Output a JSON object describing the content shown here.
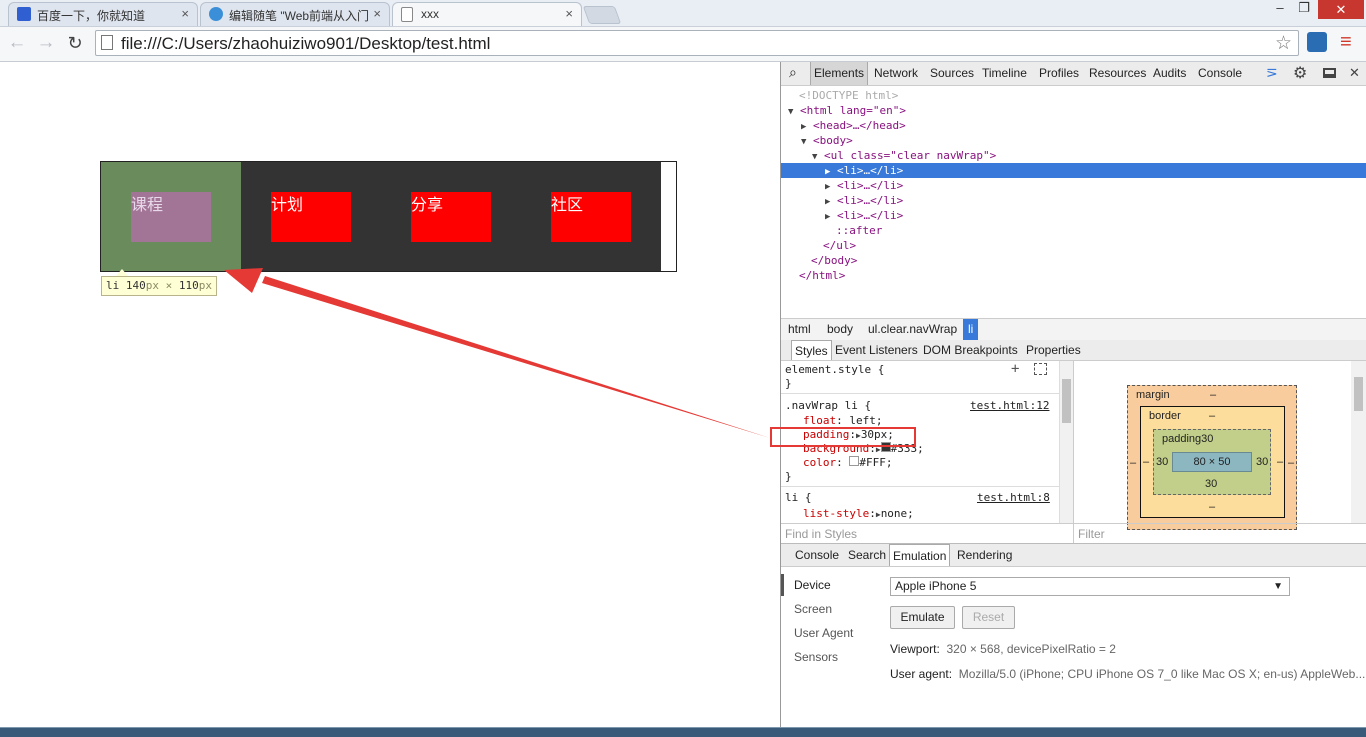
{
  "browser": {
    "tabs": [
      {
        "title": "百度一下，你就知道",
        "active": false
      },
      {
        "title": "编辑随笔 \"Web前端从入门",
        "active": false
      },
      {
        "title": "xxx",
        "active": true
      }
    ],
    "tab_close": "×",
    "url": "file:///C:/Users/zhaohuiziwo901/Desktop/test.html",
    "window_buttons": [
      "–",
      "❐",
      "✕"
    ]
  },
  "page": {
    "nav_items": [
      "课程",
      "计划",
      "分享",
      "社区"
    ],
    "tooltip": {
      "tag": "li",
      "w": "140",
      "h": "110",
      "unit": "px",
      "sep": "×"
    }
  },
  "devtools": {
    "tabs": [
      "Elements",
      "Network",
      "Sources",
      "Timeline",
      "Profiles",
      "Resources",
      "Audits",
      "Console"
    ],
    "dom": [
      {
        "text": "<!DOCTYPE html>"
      },
      {
        "tri": "▼",
        "text": "<html lang=\"en\">"
      },
      {
        "tri": "▶",
        "text": "<head>…</head>"
      },
      {
        "tri": "▼",
        "text": "<body>"
      },
      {
        "tri": "▼",
        "text": "<ul class=\"clear navWrap\">"
      },
      {
        "tri": "▶",
        "text": "<li>…</li>"
      },
      {
        "tri": "▶",
        "text": "<li>…</li>"
      },
      {
        "tri": "▶",
        "text": "<li>…</li>"
      },
      {
        "tri": "▶",
        "text": "<li>…</li>"
      },
      {
        "text": "::after"
      },
      {
        "text": "</ul>"
      },
      {
        "text": "</body>"
      },
      {
        "text": "</html>"
      }
    ],
    "breadcrumbs": [
      "html",
      "body",
      "ul.clear.navWrap",
      "li"
    ],
    "subtabs": [
      "Styles",
      "Event Listeners",
      "DOM Breakpoints",
      "Properties"
    ],
    "styles": {
      "element_style": "element.style {",
      "close": "}",
      "rule1_selector": ".navWrap li {",
      "rule1_source": "test.html:12",
      "rule1_props": [
        {
          "name": "float",
          "value": "left;"
        },
        {
          "name": "padding",
          "value": "30px;"
        },
        {
          "name": "background",
          "value": "#333;"
        },
        {
          "name": "color",
          "value": "#FFF;"
        }
      ],
      "rule2_selector": "li {",
      "rule2_source": "test.html:8",
      "rule2_props": [
        {
          "name": "list-style",
          "value": "none;"
        }
      ]
    },
    "box_model": {
      "margin_label": "margin",
      "margin_val": "–",
      "border_label": "border",
      "border_val": "–",
      "padding_label": "padding30",
      "padding_left": "30",
      "padding_right": "30",
      "padding_bottom": "30",
      "content": "80 × 50",
      "margin_side": "–"
    },
    "filters": {
      "find_styles": "Find in Styles",
      "filter": "Filter"
    },
    "drawer_tabs": [
      "Console",
      "Search",
      "Emulation",
      "Rendering"
    ],
    "emulation": {
      "sidebar": [
        "Device",
        "Screen",
        "User Agent",
        "Sensors"
      ],
      "device": "Apple iPhone 5",
      "emulate_btn": "Emulate",
      "reset_btn": "Reset",
      "viewport_key": "Viewport:",
      "viewport_val": "320 × 568, devicePixelRatio = 2",
      "ua_key": "User agent:",
      "ua_val": "Mozilla/5.0 (iPhone; CPU iPhone OS 7_0 like Mac OS X; en-us) AppleWeb..."
    }
  },
  "colors": {
    "accent": "#3879d9",
    "annotation": "#e53935",
    "nav_bg": "#333333",
    "nav_box": "#ff0000"
  }
}
